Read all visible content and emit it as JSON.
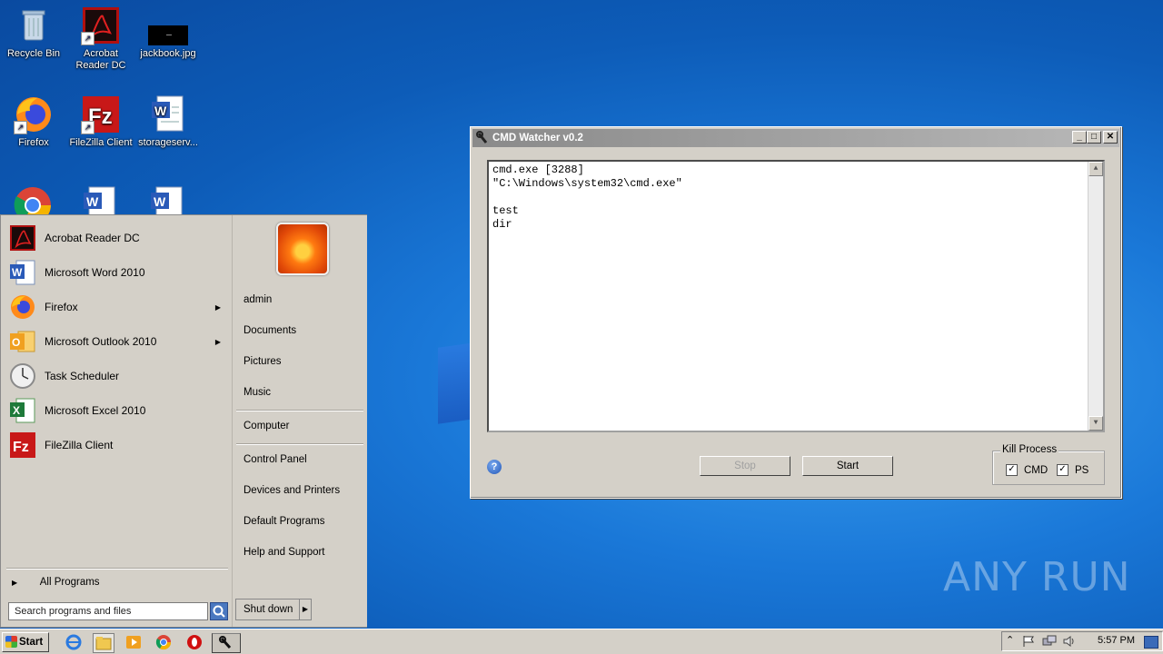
{
  "desktop": {
    "icons": [
      {
        "label": "Recycle Bin",
        "icon": "recycle-bin-icon"
      },
      {
        "label": "Acrobat Reader DC",
        "icon": "acrobat-icon"
      },
      {
        "label": "jackbook.jpg",
        "icon": "image-file-icon"
      },
      {
        "label": "Firefox",
        "icon": "firefox-icon"
      },
      {
        "label": "FileZilla Client",
        "icon": "filezilla-icon"
      },
      {
        "label": "storageserv...",
        "icon": "word-doc-icon"
      }
    ],
    "watermark": "ANY RUN"
  },
  "start_menu": {
    "programs": [
      {
        "label": "Acrobat Reader DC",
        "icon": "acrobat-icon",
        "has_submenu": false
      },
      {
        "label": "Microsoft Word 2010",
        "icon": "word-icon",
        "has_submenu": false
      },
      {
        "label": "Firefox",
        "icon": "firefox-icon",
        "has_submenu": true
      },
      {
        "label": "Microsoft Outlook 2010",
        "icon": "outlook-icon",
        "has_submenu": true
      },
      {
        "label": "Task Scheduler",
        "icon": "clock-icon",
        "has_submenu": false
      },
      {
        "label": "Microsoft Excel 2010",
        "icon": "excel-icon",
        "has_submenu": false
      },
      {
        "label": "FileZilla Client",
        "icon": "filezilla-icon",
        "has_submenu": false
      }
    ],
    "all_programs": "All Programs",
    "search_placeholder": "Search programs and files",
    "right_items": [
      "admin",
      "Documents",
      "Pictures",
      "Music",
      "Computer",
      "Control Panel",
      "Devices and Printers",
      "Default Programs",
      "Help and Support"
    ],
    "shutdown_label": "Shut down"
  },
  "window": {
    "title": "CMD Watcher v0.2",
    "text_lines": [
      "cmd.exe [3288]",
      "\"C:\\Windows\\system32\\cmd.exe\"",
      "",
      "test",
      "dir"
    ],
    "stop_label": "Stop",
    "start_label": "Start",
    "kill_group_label": "Kill Process",
    "kill_cmd_label": "CMD",
    "kill_cmd_checked": true,
    "kill_ps_label": "PS",
    "kill_ps_checked": true
  },
  "taskbar": {
    "start_label": "Start",
    "clock": "5:57 PM"
  }
}
